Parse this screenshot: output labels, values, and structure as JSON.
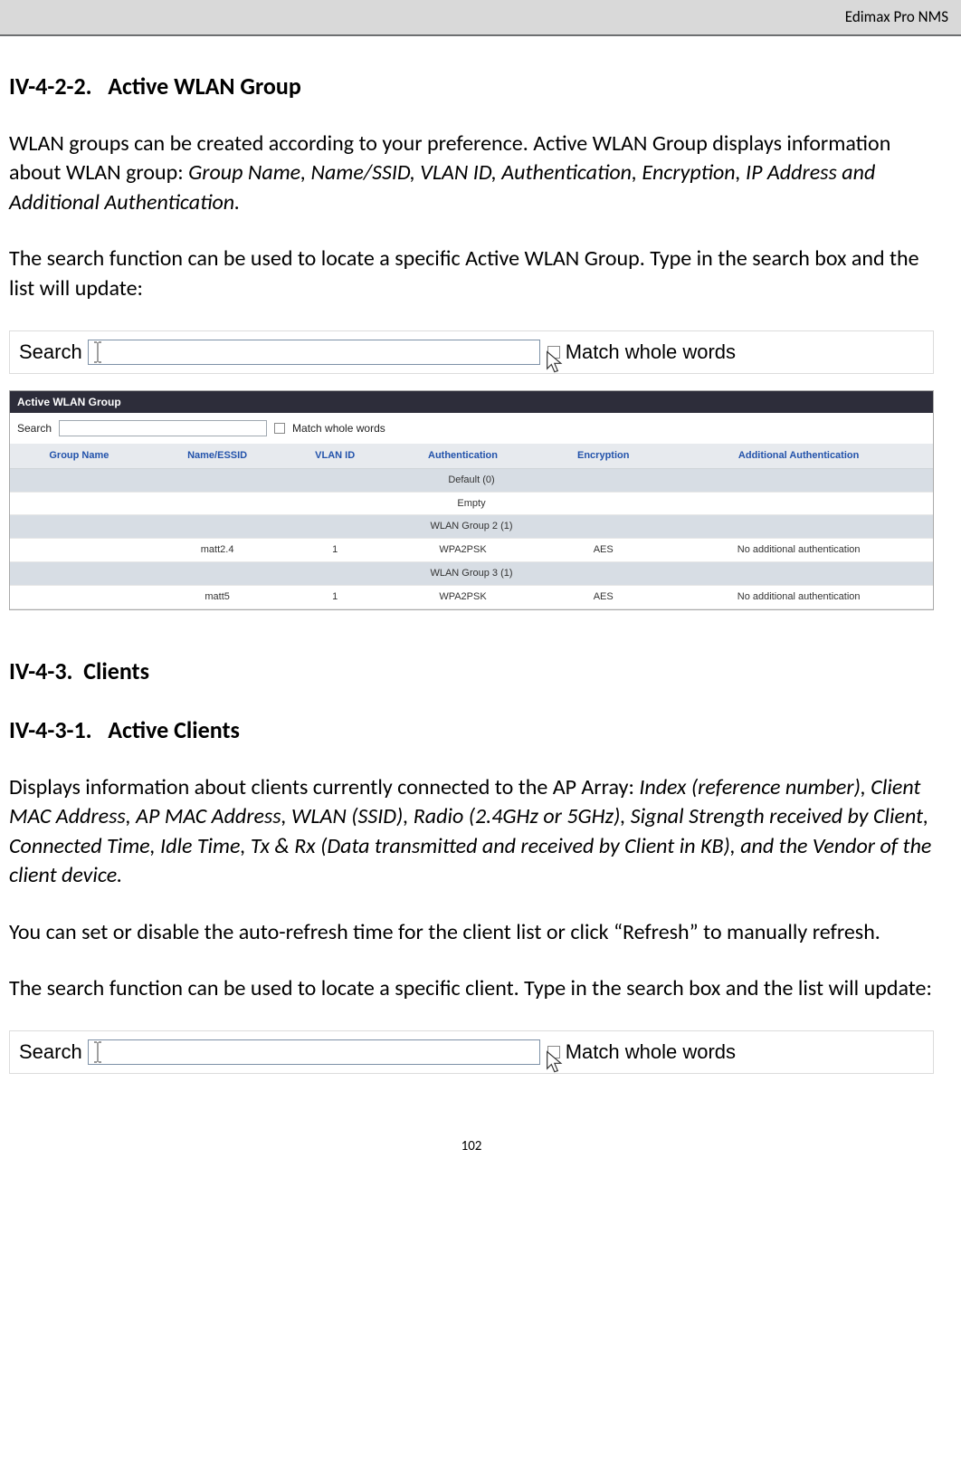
{
  "header": {
    "product": "Edimax Pro NMS"
  },
  "sections": {
    "wlan": {
      "number": "IV-4-2-2.",
      "title": "Active WLAN Group",
      "intro_plain": "WLAN groups can be created according to your preference. Active WLAN Group displays information about WLAN group: ",
      "intro_italic": "Group Name, Name/SSID, VLAN ID, Authentication, Encryption, IP Address and Additional Authentication.",
      "search_desc": "The search function can be used to locate a specific Active WLAN Group. Type in the search box and the list will update:"
    },
    "clients_parent": {
      "number": "IV-4-3.",
      "title": "Clients"
    },
    "clients": {
      "number": "IV-4-3-1.",
      "title": "Active Clients",
      "intro_plain": "Displays information about clients currently connected to the AP Array: ",
      "intro_italic": "Index (reference number), Client MAC Address, AP MAC Address, WLAN (SSID), Radio (2.4GHz or 5GHz), Signal Strength received by Client, Connected Time, Idle Time, Tx & Rx (Data transmitted and received by Client in KB), and the Vendor of the client device.",
      "refresh_desc": "You can set or disable the auto-refresh time for the client list or click “Refresh” to manually refresh.",
      "search_desc": "The search function can be used to locate a specific client. Type in the search box and the list will update:"
    }
  },
  "search_widget": {
    "label": "Search",
    "placeholder": "",
    "match_label": "Match whole words"
  },
  "wlan_table": {
    "panel_title": "Active WLAN Group",
    "search_label": "Search",
    "match_label": "Match whole words",
    "columns": [
      "Group Name",
      "Name/ESSID",
      "VLAN ID",
      "Authentication",
      "Encryption",
      "Additional Authentication"
    ],
    "groups": [
      {
        "name": "Default (0)",
        "rows": [
          {
            "empty": "Empty"
          }
        ]
      },
      {
        "name": "WLAN Group 2 (1)",
        "rows": [
          {
            "essid": "matt2.4",
            "vlan": "1",
            "auth": "WPA2PSK",
            "enc": "AES",
            "addl": "No additional authentication"
          }
        ]
      },
      {
        "name": "WLAN Group 3 (1)",
        "rows": [
          {
            "essid": "matt5",
            "vlan": "1",
            "auth": "WPA2PSK",
            "enc": "AES",
            "addl": "No additional authentication"
          }
        ]
      }
    ]
  },
  "footer": {
    "page_no": "102"
  }
}
